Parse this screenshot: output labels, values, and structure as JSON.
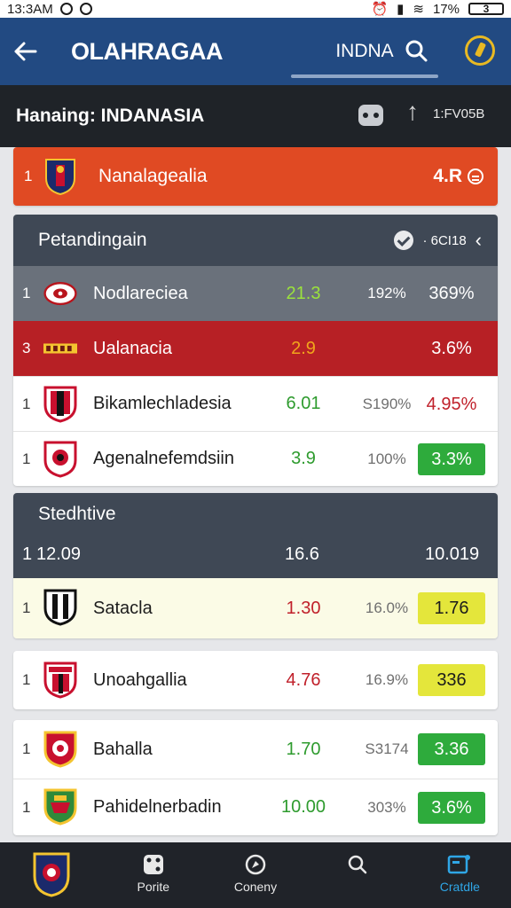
{
  "status_bar": {
    "time": "13:3AM",
    "battery": "17%",
    "sim": "3"
  },
  "app_bar": {
    "title": "OLAHRAGAA",
    "tab_label": "INDNA"
  },
  "league_bar": {
    "title": "Hanaing: INDANASIA",
    "code": "1:FV05B"
  },
  "top_entry": {
    "rank": "1",
    "name": "Nanalagealia",
    "value": "4.R"
  },
  "section1": {
    "title": "Petandingain",
    "tool_label": "· 6CI18",
    "rows": [
      {
        "rank": "1",
        "name": "Nodlareciea",
        "v1": "21.3",
        "v2": "192%",
        "v3": "369%",
        "style": "grey",
        "v1_color": "lime"
      },
      {
        "rank": "3",
        "name": "Ualanacia",
        "v1": "2.9",
        "v2": "",
        "v3": "3.6%",
        "style": "red",
        "v1_color": "orange"
      },
      {
        "rank": "1",
        "name": "Bikamlechladesia",
        "v1": "6.01",
        "v2": "S190%",
        "v3": "4.95%",
        "style": "white",
        "v1_color": "green"
      },
      {
        "rank": "1",
        "name": "Agenalnefemdsiin",
        "v1": "3.9",
        "v2": "100%",
        "v3": "3.3%",
        "style": "white",
        "v1_color": "green"
      }
    ]
  },
  "section2": {
    "title": "Stedhtive",
    "sub_rank": "1",
    "sub_value": "12.09",
    "sub_col1": "16.6",
    "sub_col2": "10.019",
    "row1": {
      "rank": "1",
      "name": "Satacla",
      "v1": "1.30",
      "v2": "16.0%",
      "v3": "1.76"
    }
  },
  "card3": {
    "rank": "1",
    "name": "Unoahgallia",
    "v1": "4.76",
    "v2": "16.9%",
    "v3": "336"
  },
  "card4": {
    "rows": [
      {
        "rank": "1",
        "name": "Bahalla",
        "v1": "1.70",
        "v2": "S3174",
        "v3": "3.36"
      },
      {
        "rank": "1",
        "name": "Pahidelnerbadin",
        "v1": "10.00",
        "v2": "303%",
        "v3": "3.6%"
      }
    ]
  },
  "bottom_nav": {
    "items": [
      {
        "label": "",
        "icon": "team-crest-icon"
      },
      {
        "label": "Porite",
        "icon": "dice-icon"
      },
      {
        "label": "Coneny",
        "icon": "compass-icon"
      },
      {
        "label": "",
        "icon": "search-icon"
      },
      {
        "label": "Cratdle",
        "icon": "media-icon"
      }
    ]
  },
  "colors": {
    "app_bar": "#224a82",
    "league_bar": "#1f2328",
    "top_entry": "#e04a23",
    "section_head": "#3f4855",
    "highlight_red": "#b72025",
    "badge_green": "#2eab3c",
    "badge_yellow": "#e4e63b",
    "nav_active": "#2fa6e6"
  }
}
